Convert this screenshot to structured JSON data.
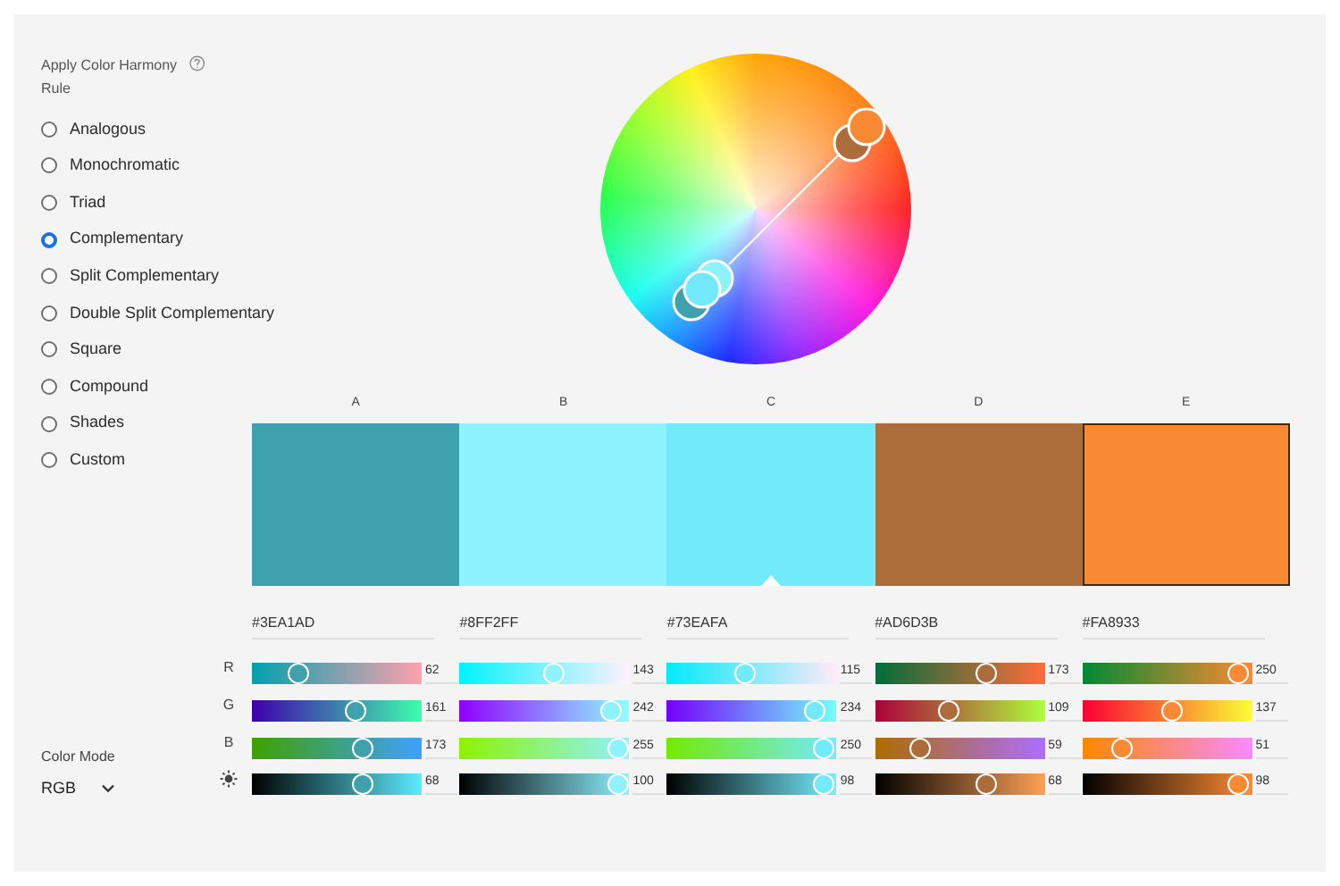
{
  "sidebar": {
    "title": "Apply Color Harmony Rule",
    "rules": [
      {
        "label": "Analogous",
        "selected": false
      },
      {
        "label": "Monochromatic",
        "selected": false
      },
      {
        "label": "Triad",
        "selected": false
      },
      {
        "label": "Complementary",
        "selected": true
      },
      {
        "label": "Split Complementary",
        "selected": false
      },
      {
        "label": "Double Split Complementary",
        "selected": false
      },
      {
        "label": "Square",
        "selected": false
      },
      {
        "label": "Compound",
        "selected": false
      },
      {
        "label": "Shades",
        "selected": false
      },
      {
        "label": "Custom",
        "selected": false
      }
    ]
  },
  "color_mode": {
    "label": "Color Mode",
    "value": "RGB"
  },
  "channels": [
    {
      "kind": "red",
      "label": "R"
    },
    {
      "kind": "green",
      "label": "G"
    },
    {
      "kind": "blue",
      "label": "B"
    },
    {
      "kind": "brightness"
    }
  ],
  "swatches": [
    {
      "label": "A",
      "color": "#3ea1ad",
      "hex": "#3EA1AD",
      "base": false,
      "selected": false,
      "sliders": [
        {
          "value": "62",
          "level": 0.243
        },
        {
          "value": "161",
          "level": 0.631
        },
        {
          "value": "173",
          "level": 0.678
        },
        {
          "value": "68",
          "level": 0.68
        }
      ]
    },
    {
      "label": "B",
      "color": "#8ff2ff",
      "hex": "#8FF2FF",
      "base": false,
      "selected": false,
      "sliders": [
        {
          "value": "143",
          "level": 0.561
        },
        {
          "value": "242",
          "level": 0.949
        },
        {
          "value": "255",
          "level": 1
        },
        {
          "value": "100",
          "level": 1
        }
      ]
    },
    {
      "label": "C",
      "color": "#73eafa",
      "hex": "#73EAFA",
      "base": true,
      "selected": false,
      "sliders": [
        {
          "value": "115",
          "level": 0.451
        },
        {
          "value": "234",
          "level": 0.918
        },
        {
          "value": "250",
          "level": 0.98
        },
        {
          "value": "98",
          "level": 0.98
        }
      ]
    },
    {
      "label": "D",
      "color": "#ad6d3b",
      "hex": "#AD6D3B",
      "base": false,
      "selected": false,
      "sliders": [
        {
          "value": "173",
          "level": 0.678
        },
        {
          "value": "109",
          "level": 0.427
        },
        {
          "value": "59",
          "level": 0.231
        },
        {
          "value": "68",
          "level": 0.68
        }
      ]
    },
    {
      "label": "E",
      "color": "#fa8933",
      "hex": "#FA8933",
      "base": false,
      "selected": true,
      "sliders": [
        {
          "value": "250",
          "level": 0.98
        },
        {
          "value": "137",
          "level": 0.537
        },
        {
          "value": "51",
          "level": 0.2
        },
        {
          "value": "98",
          "level": 0.98
        }
      ]
    }
  ]
}
